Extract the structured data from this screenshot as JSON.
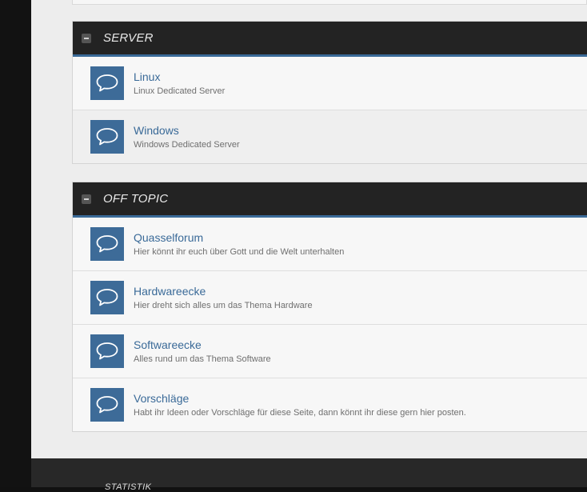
{
  "categories": [
    {
      "title": "SERVER",
      "forums": [
        {
          "title": "Linux",
          "description": "Linux Dedicated Server",
          "icon": "speech-bubble-icon"
        },
        {
          "title": "Windows",
          "description": "Windows Dedicated Server",
          "icon": "speech-bubble-icon"
        }
      ]
    },
    {
      "title": "OFF TOPIC",
      "forums": [
        {
          "title": "Quasselforum",
          "description": "Hier könnt ihr euch über Gott und die Welt unterhalten",
          "icon": "speech-bubble-icon"
        },
        {
          "title": "Hardwareecke",
          "description": "Hier dreht sich alles um das Thema Hardware",
          "icon": "speech-bubble-icon"
        },
        {
          "title": "Softwareecke",
          "description": "Alles rund um das Thema Software",
          "icon": "speech-bubble-icon"
        },
        {
          "title": "Vorschläge",
          "description": "Habt ihr Ideen oder Vorschläge für diese Seite, dann könnt ihr diese gern hier posten.",
          "icon": "speech-bubble-icon"
        }
      ]
    }
  ],
  "footer": {
    "section_title": "STATISTIK"
  },
  "colors": {
    "accent": "#3a6a98",
    "header_bg": "#232323",
    "icon_bg": "#3d6b98"
  }
}
